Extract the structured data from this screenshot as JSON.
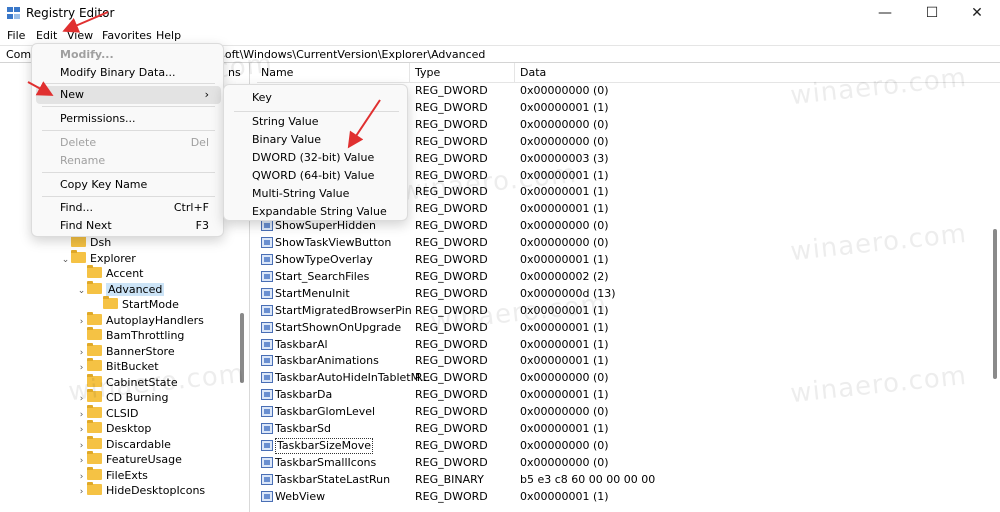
{
  "window": {
    "title": "Registry Editor",
    "minimize_glyph": "—",
    "maximize_glyph": "☐",
    "close_glyph": "✕"
  },
  "menubar": [
    "File",
    "Edit",
    "View",
    "Favorites",
    "Help"
  ],
  "address": {
    "prefix": "Comp",
    "path": "rosoft\\Windows\\CurrentVersion\\Explorer\\Advanced"
  },
  "tree": {
    "column_fragment": "ns",
    "items": [
      {
        "label": "Dsh",
        "expand": ""
      },
      {
        "label": "Explorer",
        "expand": "expanded"
      },
      {
        "label": "Accent",
        "expand": ""
      },
      {
        "label": "Advanced",
        "expand": "expanded",
        "selected": true
      },
      {
        "label": "StartMode",
        "expand": ""
      },
      {
        "label": "AutoplayHandlers",
        "expand": "collapsed"
      },
      {
        "label": "BamThrottling",
        "expand": ""
      },
      {
        "label": "BannerStore",
        "expand": "collapsed"
      },
      {
        "label": "BitBucket",
        "expand": "collapsed"
      },
      {
        "label": "CabinetState",
        "expand": ""
      },
      {
        "label": "CD Burning",
        "expand": "collapsed"
      },
      {
        "label": "CLSID",
        "expand": "collapsed"
      },
      {
        "label": "Desktop",
        "expand": "collapsed"
      },
      {
        "label": "Discardable",
        "expand": "collapsed"
      },
      {
        "label": "FeatureUsage",
        "expand": "collapsed"
      },
      {
        "label": "FileExts",
        "expand": "collapsed"
      },
      {
        "label": "HideDesktopIcons",
        "expand": "collapsed"
      }
    ]
  },
  "list": {
    "headers": {
      "name": "Name",
      "type": "Type",
      "data": "Data"
    },
    "rows": [
      {
        "name": "",
        "type": "REG_DWORD",
        "data": "0x00000000 (0)"
      },
      {
        "name": "",
        "type": "REG_DWORD",
        "data": "0x00000001 (1)"
      },
      {
        "name": "",
        "type": "REG_DWORD",
        "data": "0x00000000 (0)"
      },
      {
        "name": "",
        "type": "REG_DWORD",
        "data": "0x00000000 (0)"
      },
      {
        "name": "",
        "type": "REG_DWORD",
        "data": "0x00000003 (3)"
      },
      {
        "name": "",
        "type": "REG_DWORD",
        "data": "0x00000001 (1)"
      },
      {
        "name": "",
        "type": "REG_DWORD",
        "data": "0x00000001 (1)"
      },
      {
        "name": "",
        "type": "REG_DWORD",
        "data": "0x00000001 (1)"
      },
      {
        "name": "ShowSuperHidden",
        "type": "REG_DWORD",
        "data": "0x00000000 (0)"
      },
      {
        "name": "ShowTaskViewButton",
        "type": "REG_DWORD",
        "data": "0x00000000 (0)"
      },
      {
        "name": "ShowTypeOverlay",
        "type": "REG_DWORD",
        "data": "0x00000001 (1)"
      },
      {
        "name": "Start_SearchFiles",
        "type": "REG_DWORD",
        "data": "0x00000002 (2)"
      },
      {
        "name": "StartMenuInit",
        "type": "REG_DWORD",
        "data": "0x0000000d (13)"
      },
      {
        "name": "StartMigratedBrowserPin",
        "type": "REG_DWORD",
        "data": "0x00000001 (1)"
      },
      {
        "name": "StartShownOnUpgrade",
        "type": "REG_DWORD",
        "data": "0x00000001 (1)"
      },
      {
        "name": "TaskbarAl",
        "type": "REG_DWORD",
        "data": "0x00000001 (1)"
      },
      {
        "name": "TaskbarAnimations",
        "type": "REG_DWORD",
        "data": "0x00000001 (1)"
      },
      {
        "name": "TaskbarAutoHideInTabletM...",
        "type": "REG_DWORD",
        "data": "0x00000000 (0)"
      },
      {
        "name": "TaskbarDa",
        "type": "REG_DWORD",
        "data": "0x00000001 (1)"
      },
      {
        "name": "TaskbarGlomLevel",
        "type": "REG_DWORD",
        "data": "0x00000000 (0)"
      },
      {
        "name": "TaskbarSd",
        "type": "REG_DWORD",
        "data": "0x00000001 (1)"
      },
      {
        "name": "TaskbarSizeMove",
        "type": "REG_DWORD",
        "data": "0x00000000 (0)",
        "focused": true
      },
      {
        "name": "TaskbarSmallIcons",
        "type": "REG_DWORD",
        "data": "0x00000000 (0)"
      },
      {
        "name": "TaskbarStateLastRun",
        "type": "REG_BINARY",
        "data": "b5 e3 c8 60 00 00 00 00"
      },
      {
        "name": "WebView",
        "type": "REG_DWORD",
        "data": "0x00000001 (1)"
      }
    ]
  },
  "edit_menu": {
    "items": [
      {
        "label": "Modify...",
        "disabled": true,
        "bold": true
      },
      {
        "label": "Modify Binary Data...",
        "disabled": false
      },
      {
        "separator": true
      },
      {
        "label": "New",
        "submenu": true,
        "hover": true
      },
      {
        "separator": true
      },
      {
        "label": "Permissions...",
        "disabled": false
      },
      {
        "separator": true
      },
      {
        "label": "Delete",
        "shortcut": "Del",
        "disabled": true
      },
      {
        "label": "Rename",
        "disabled": true
      },
      {
        "separator": true
      },
      {
        "label": "Copy Key Name",
        "disabled": false
      },
      {
        "separator": true
      },
      {
        "label": "Find...",
        "shortcut": "Ctrl+F",
        "disabled": false
      },
      {
        "label": "Find Next",
        "shortcut": "F3",
        "disabled": false
      }
    ],
    "submenu_arrow": "›"
  },
  "new_submenu": {
    "items": [
      {
        "label": "Key"
      },
      {
        "separator": true
      },
      {
        "label": "String Value"
      },
      {
        "label": "Binary Value"
      },
      {
        "label": "DWORD (32-bit) Value"
      },
      {
        "label": "QWORD (64-bit) Value"
      },
      {
        "label": "Multi-String Value"
      },
      {
        "label": "Expandable String Value"
      }
    ]
  },
  "watermark": "winaero.com",
  "colors": {
    "arrow": "#e03030",
    "selection": "#cce4f7",
    "folder": "#f5c244"
  }
}
